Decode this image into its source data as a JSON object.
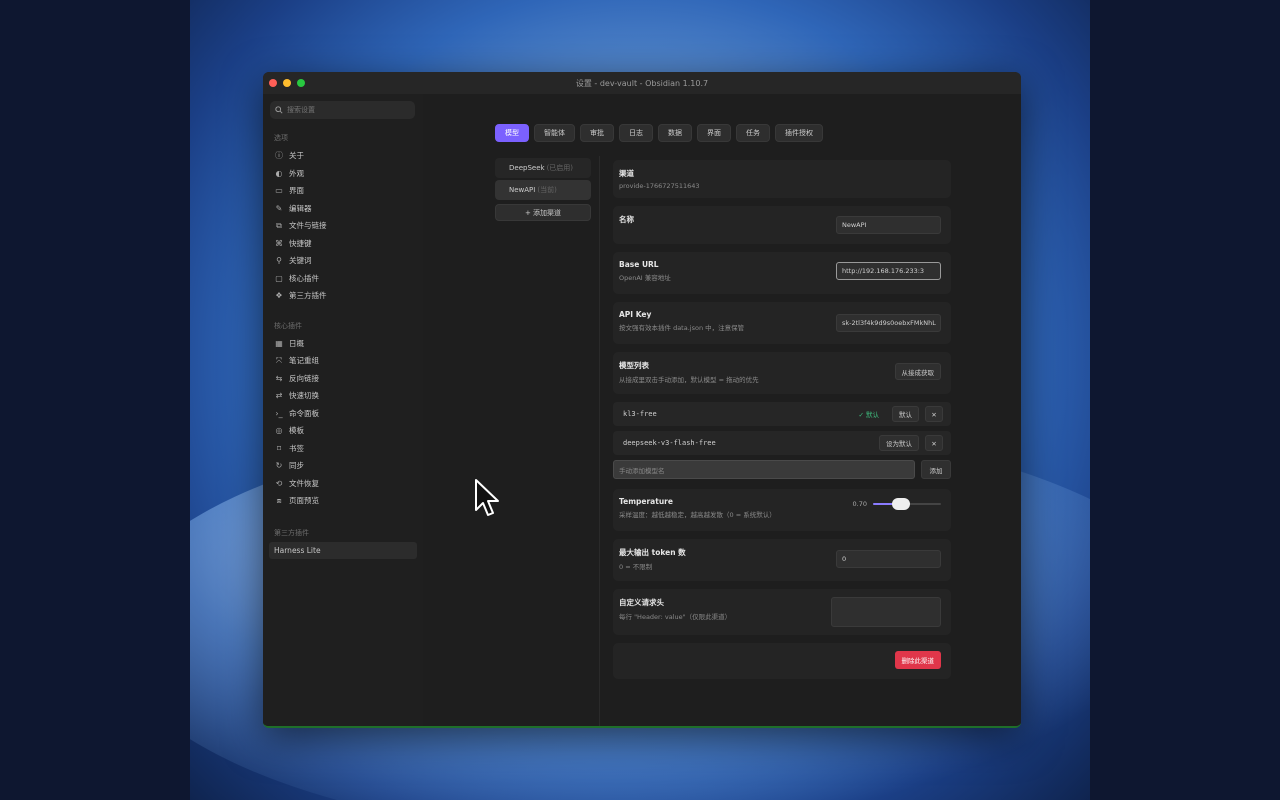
{
  "window": {
    "title": "设置 - dev-vault - Obsidian 1.10.7"
  },
  "sidebar": {
    "search_placeholder": "搜索设置",
    "options_heading": "选项",
    "options": [
      {
        "label": "关于",
        "icon": "info-icon"
      },
      {
        "label": "外观",
        "icon": "appearance-icon"
      },
      {
        "label": "界面",
        "icon": "monitor-icon"
      },
      {
        "label": "编辑器",
        "icon": "pencil-icon"
      },
      {
        "label": "文件与链接",
        "icon": "link-icon"
      },
      {
        "label": "快捷键",
        "icon": "command-icon"
      },
      {
        "label": "关键词",
        "icon": "search-icon"
      },
      {
        "label": "核心插件",
        "icon": "plugin-icon"
      },
      {
        "label": "第三方插件",
        "icon": "puzzle-icon"
      }
    ],
    "core_heading": "核心插件",
    "core": [
      {
        "label": "日概",
        "icon": "calendar-icon"
      },
      {
        "label": "笔记重组",
        "icon": "merge-icon"
      },
      {
        "label": "反向链接",
        "icon": "backlink-icon"
      },
      {
        "label": "快速切换",
        "icon": "switch-icon"
      },
      {
        "label": "命令面板",
        "icon": "terminal-icon"
      },
      {
        "label": "模板",
        "icon": "template-icon"
      },
      {
        "label": "书签",
        "icon": "bookmark-icon"
      },
      {
        "label": "同步",
        "icon": "sync-icon"
      },
      {
        "label": "文件恢复",
        "icon": "restore-icon"
      },
      {
        "label": "页面预览",
        "icon": "preview-icon"
      }
    ],
    "third_party_heading": "第三方插件",
    "third_party": [
      {
        "label": "Harness Lite"
      }
    ]
  },
  "tabs": [
    {
      "label": "模型",
      "active": true
    },
    {
      "label": "智能体"
    },
    {
      "label": "审批"
    },
    {
      "label": "日志"
    },
    {
      "label": "数据"
    },
    {
      "label": "界面"
    },
    {
      "label": "任务"
    },
    {
      "label": "插件授权"
    }
  ],
  "providers": [
    {
      "name": "DeepSeek",
      "sub": "(已启用)"
    },
    {
      "name": "NewAPI",
      "sub": "(当前)"
    }
  ],
  "add_provider_label": "+ 添加渠道",
  "provider_card": {
    "title": "渠道",
    "id": "provide-1766727511643",
    "name_label": "名称",
    "name_value": "NewAPI",
    "base_url_label": "Base URL",
    "base_url_desc": "OpenAI 兼容地址",
    "base_url_value": "http://192.168.176.233:3",
    "api_key_label": "API Key",
    "api_key_desc": "按文强有效本插件 data.json 中，注意保管",
    "api_key_value": "sk-2tl3f4k9d9s0oebxFMkNhL",
    "models_label": "模型列表",
    "models_desc": "从接成里双击手动添加，默认模型 = 拖动的优先",
    "fetch_label": "从接成获取",
    "models": [
      {
        "id": "kl3-free",
        "badge": "✓ 默认",
        "action": "默认"
      },
      {
        "id": "deepseek-v3-flash-free",
        "action": "设为默认"
      }
    ],
    "add_model_placeholder": "手动添加模型名",
    "add_label": "添加",
    "temperature_label": "Temperature",
    "temperature_desc": "采样温度：越低越稳定，越高越发散（0 = 系统默认）",
    "temperature_value": "0.70",
    "temperature_fraction": 0.38,
    "max_tokens_label": "最大输出 token 数",
    "max_tokens_desc": "0 = 不限制",
    "max_tokens_value": "0",
    "headers_label": "自定义请求头",
    "headers_desc": "每行 \"Header: value\"（仅限此渠道）",
    "delete_label": "删除此渠道"
  },
  "colors": {
    "accent": "#7b61ff",
    "danger": "#e0364a"
  }
}
